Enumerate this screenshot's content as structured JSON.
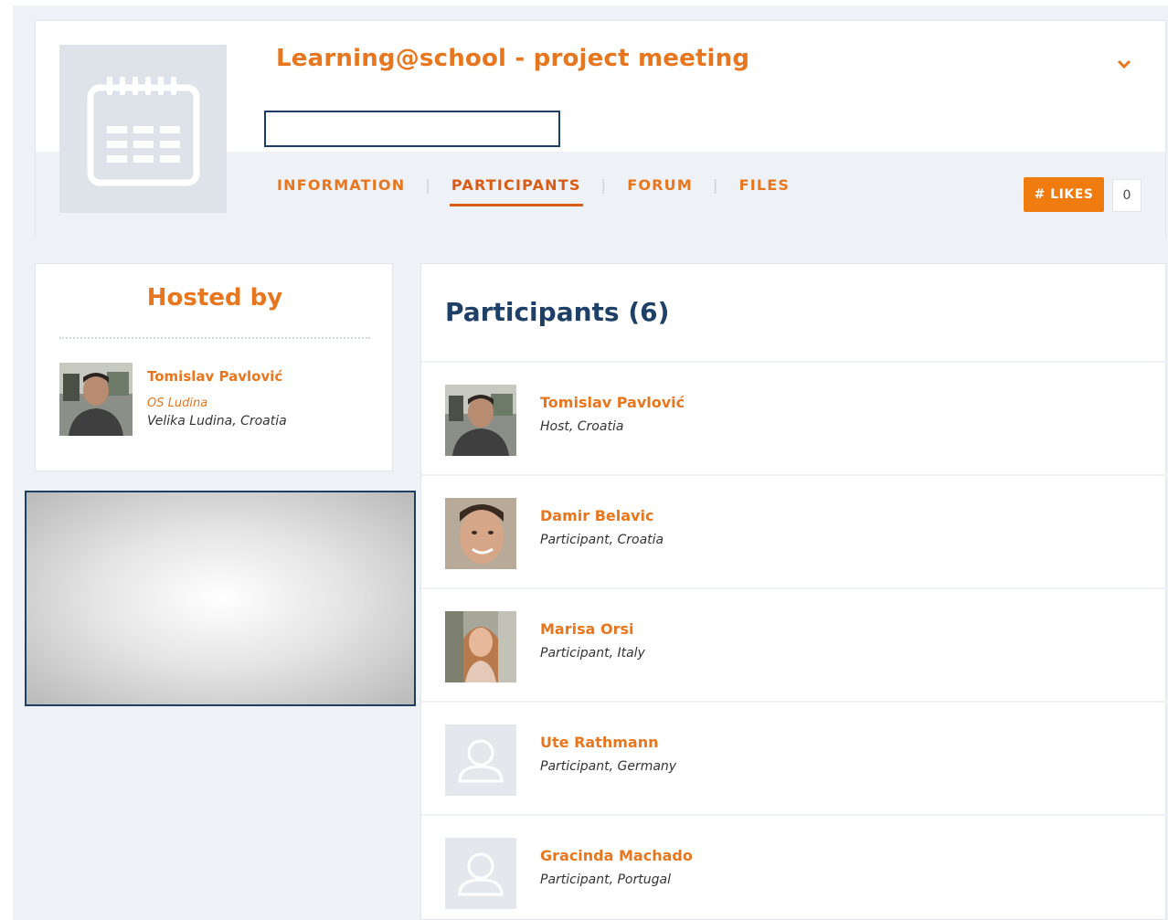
{
  "event": {
    "title": "Learning@school - project meeting",
    "icon": "calendar-icon"
  },
  "tabs": [
    {
      "label": "INFORMATION"
    },
    {
      "label": "PARTICIPANTS",
      "active": true
    },
    {
      "label": "FORUM"
    },
    {
      "label": "FILES"
    }
  ],
  "likes": {
    "label": "# LIKES",
    "count": "0"
  },
  "host": {
    "heading": "Hosted by",
    "name": "Tomislav Pavlović",
    "organization": "OS Ludina",
    "location": "Velika Ludina, Croatia"
  },
  "participants": {
    "title": "Participants (6)",
    "items": [
      {
        "name": "Tomislav Pavlović",
        "role": "Host, Croatia"
      },
      {
        "name": "Damir Belavic",
        "role": "Participant, Croatia"
      },
      {
        "name": "Marisa Orsi",
        "role": "Participant, Italy"
      },
      {
        "name": "Ute Rathmann",
        "role": "Participant, Germany"
      },
      {
        "name": "Gracinda Machado",
        "role": "Participant, Portugal"
      }
    ]
  },
  "colors": {
    "accent": "#e8761e",
    "title_blue": "#1e3f66",
    "likes_bg": "#f07c0f",
    "page_bg": "#eef2f6"
  }
}
